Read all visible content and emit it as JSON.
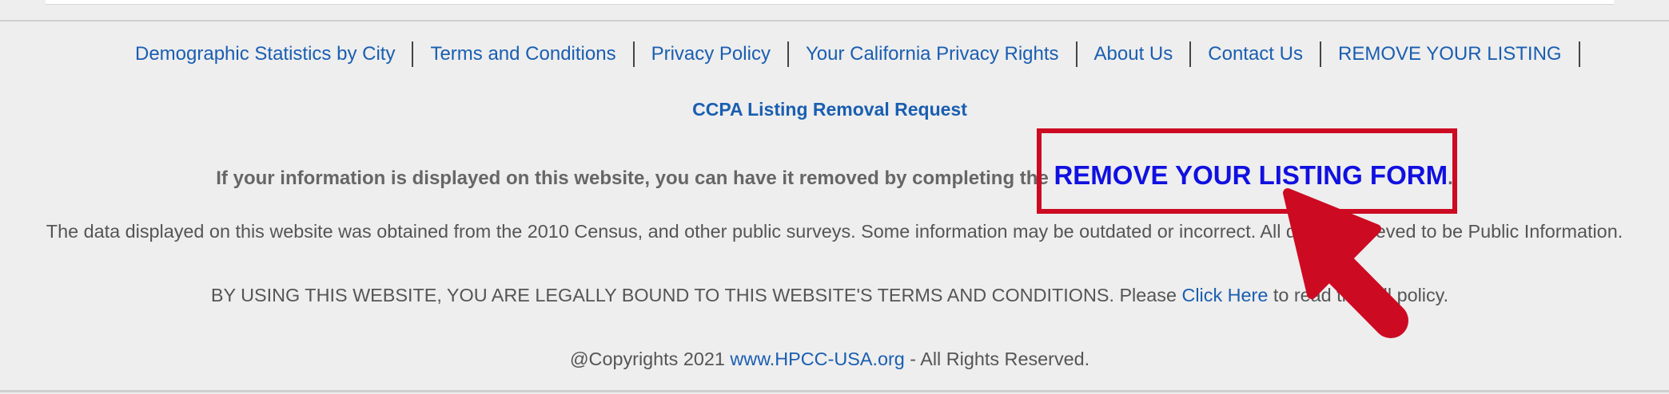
{
  "footer_nav": {
    "links": [
      {
        "label": "Demographic Statistics by City"
      },
      {
        "label": "Terms and Conditions"
      },
      {
        "label": "Privacy Policy"
      },
      {
        "label": "Your California Privacy Rights"
      },
      {
        "label": "About Us"
      },
      {
        "label": "Contact Us"
      },
      {
        "label": "REMOVE YOUR LISTING"
      }
    ]
  },
  "ccpa_link": "CCPA Listing Removal Request",
  "removal": {
    "prefix": "If your information is displayed on this website, you can have it removed by completing the ",
    "link": "REMOVE YOUR LISTING FORM",
    "suffix": "."
  },
  "data_notice": "The data displayed on this website was obtained from the 2010 Census, and other public surveys. Some information may be outdated or incorrect. All data is believed to be Public Information.",
  "legal": {
    "prefix": "BY USING THIS WEBSITE, YOU ARE LEGALLY BOUND TO THIS WEBSITE'S TERMS AND CONDITIONS. Please ",
    "link": "Click Here",
    "suffix": " to read the full policy."
  },
  "copyright": {
    "prefix": "@Copyrights 2021 ",
    "link": "www.HPCC-USA.org",
    "suffix": " - All Rights Reserved."
  },
  "colors": {
    "link": "#1a5eb1",
    "annotation_red": "#cc0a22",
    "form_link": "#1010e0"
  }
}
